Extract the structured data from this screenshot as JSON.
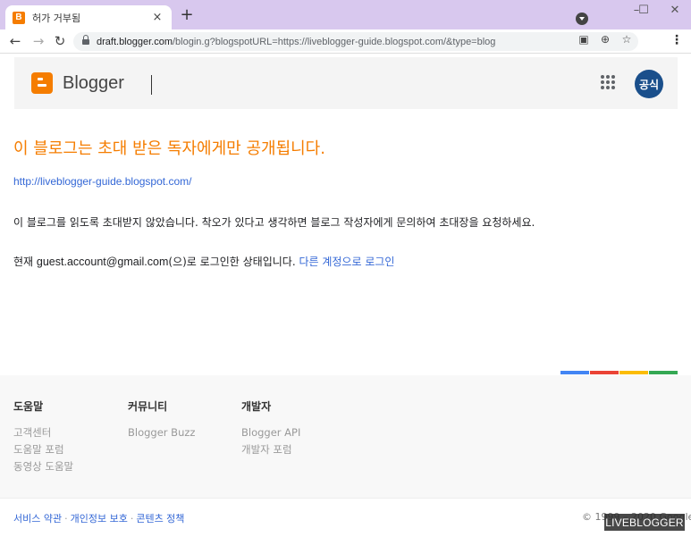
{
  "browser": {
    "tab_title": "허가 거부됨",
    "tab_favicon": "B",
    "tab_close": "×",
    "new_tab": "+",
    "window_controls": [
      "–",
      "☐",
      "✕"
    ],
    "nav": {
      "back": "←",
      "forward": "→",
      "reload": "↻"
    },
    "url_host": "draft.blogger.com",
    "url_rest": "/blogin.g?blogspotURL=https://liveblogger-guide.blogspot.com/&type=blog",
    "omni_icons": [
      "qr-icon",
      "zoom-icon",
      "star-icon"
    ],
    "omni_glyphs": [
      "▣",
      "⊕",
      "☆"
    ],
    "menu": "⋮"
  },
  "header": {
    "logo_text": "Blogger",
    "avatar_text": "공식",
    "logo_color": "#f57d00",
    "avatar_color": "#1a4f8b"
  },
  "main": {
    "title": "이 블로그는 초대 받은 독자에게만 공개됩니다.",
    "blog_url": "http://liveblogger-guide.blogspot.com/",
    "message": "이 블로그를 읽도록 초대받지 않았습니다. 착오가 있다고 생각하면 블로그 작성자에게 문의하여 초대장을 요청하세요.",
    "login_prefix": "현재 ",
    "login_email": "guest.account@gmail.com",
    "login_suffix": "(으)로 로그인한 상태입니다. ",
    "switch_account": "다른 계정으로 로그인"
  },
  "color_bar": [
    "#4285f4",
    "#ea4335",
    "#fbbc05",
    "#34a853"
  ],
  "footer": {
    "columns": [
      {
        "heading": "도움말",
        "links": [
          "고객센터",
          "도움말 포럼",
          "동영상 도움말"
        ]
      },
      {
        "heading": "커뮤니티",
        "links": [
          "Blogger Buzz"
        ]
      },
      {
        "heading": "개발자",
        "links": [
          "Blogger API",
          "개발자 포럼"
        ]
      }
    ],
    "legal": [
      "서비스 약관",
      "개인정보 보호",
      "콘텐츠 정책"
    ],
    "legal_separator": "·",
    "copyright": "© 1999 – 2020 Google"
  },
  "watermark": "LIVEBLOGGER"
}
